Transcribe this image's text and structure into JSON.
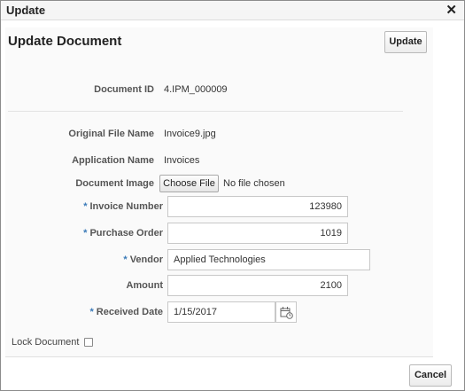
{
  "window": {
    "title": "Update",
    "close_glyph": "✕"
  },
  "header": {
    "title": "Update Document",
    "update_label": "Update"
  },
  "form": {
    "document_id": {
      "label": "Document ID",
      "value": "4.IPM_000009"
    },
    "original_file_name": {
      "label": "Original File Name",
      "value": "Invoice9.jpg"
    },
    "application_name": {
      "label": "Application Name",
      "value": "Invoices"
    },
    "document_image": {
      "label": "Document Image",
      "button": "Choose File",
      "status": "No file chosen"
    },
    "invoice_number": {
      "label": "Invoice Number",
      "required": "*",
      "value": "123980"
    },
    "purchase_order": {
      "label": "Purchase Order",
      "required": "*",
      "value": "1019"
    },
    "vendor": {
      "label": "Vendor",
      "required": "*",
      "value": "Applied Technologies"
    },
    "amount": {
      "label": "Amount",
      "value": "2100"
    },
    "received_date": {
      "label": "Received Date",
      "required": "*",
      "value": "1/15/2017",
      "icon": "calendar-icon"
    }
  },
  "lock_document": {
    "label": "Lock Document",
    "checked": false
  },
  "footer": {
    "cancel_label": "Cancel"
  }
}
